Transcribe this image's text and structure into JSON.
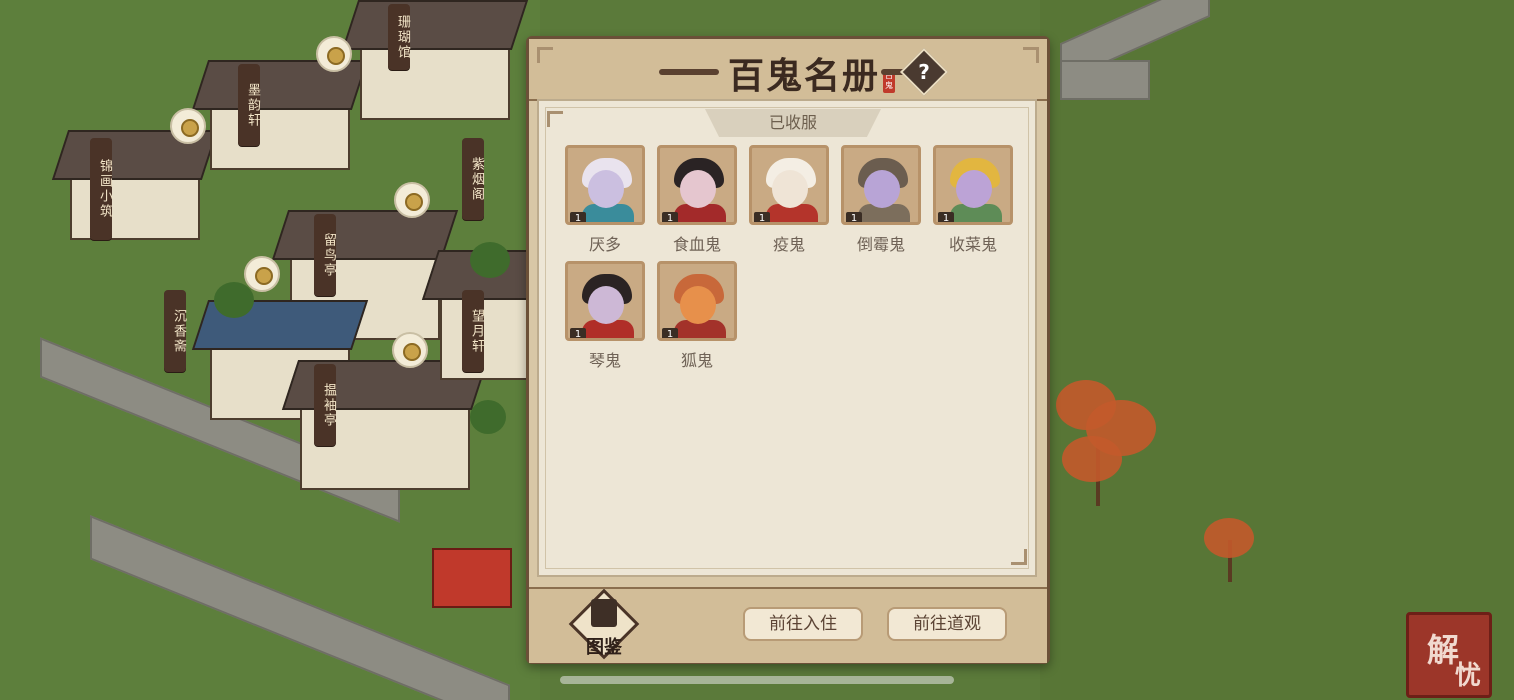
{
  "world": {
    "shop_signs": [
      "珊瑚馆",
      "墨韵轩",
      "锦画小筑",
      "紫烟阁",
      "留鸟亭",
      "沉香斋",
      "望月轩",
      "揾袖亭"
    ]
  },
  "modal": {
    "title": "百鬼名册",
    "title_seal": "百鬼",
    "help_icon": "?",
    "tab_label": "已收服",
    "ghosts": [
      {
        "name": "厌多",
        "level": "1",
        "palette": {
          "face": "#cbbfe0",
          "hair": "#e9e3ee",
          "body": "#3a8c9b"
        }
      },
      {
        "name": "食血鬼",
        "level": "1",
        "palette": {
          "face": "#e5c6cf",
          "hair": "#2a2324",
          "body": "#a32a2a"
        }
      },
      {
        "name": "疫鬼",
        "level": "1",
        "palette": {
          "face": "#efe4d6",
          "hair": "#f4eee4",
          "body": "#b4342b"
        }
      },
      {
        "name": "倒霉鬼",
        "level": "1",
        "palette": {
          "face": "#b8a4d6",
          "hair": "#6b5d4f",
          "body": "#7c6e5c"
        }
      },
      {
        "name": "收菜鬼",
        "level": "1",
        "palette": {
          "face": "#bca3d6",
          "hair": "#e2b640",
          "body": "#5e8c57"
        }
      },
      {
        "name": "琴鬼",
        "level": "1",
        "palette": {
          "face": "#cdb8d6",
          "hair": "#2b2323",
          "body": "#b02e28"
        }
      },
      {
        "name": "狐鬼",
        "level": "1",
        "palette": {
          "face": "#e7904b",
          "hair": "#c8683a",
          "body": "#a3322a"
        }
      }
    ],
    "footer": {
      "codex_label": "图鉴",
      "btn_move_in": "前往入住",
      "btn_temple": "前往道观"
    }
  },
  "corner_badge": {
    "line1": "解",
    "line2": "忧"
  }
}
